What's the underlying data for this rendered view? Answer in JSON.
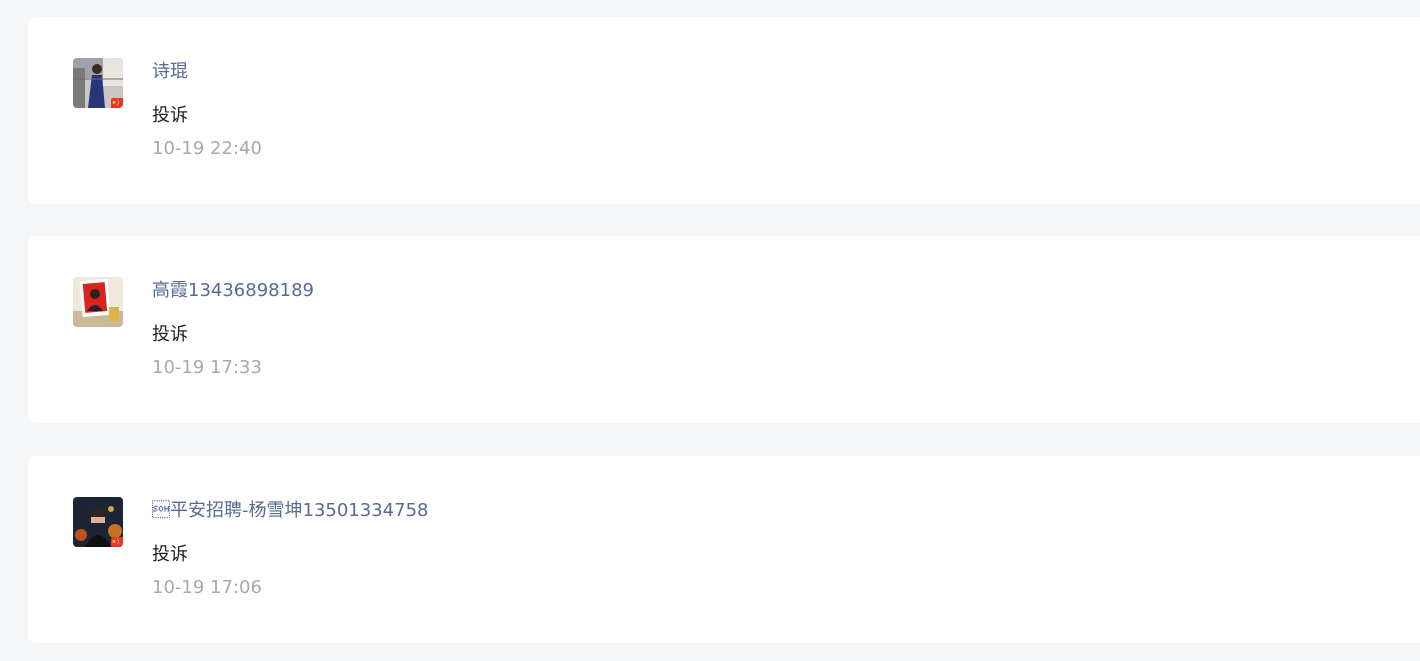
{
  "comments": [
    {
      "author": "诗琨",
      "text": "投诉",
      "time": "10-19 22:40",
      "avatar": "woman-in-blue-dress-photo",
      "badge": "china-flag-icon"
    },
    {
      "author": "高霞13436898189",
      "text": "投诉",
      "time": "10-19 17:33",
      "avatar": "framed-portrait-photo",
      "badge": ""
    },
    {
      "author": "\u0001平安招聘-杨雪坤13501334758",
      "text": "投诉",
      "time": "10-19 17:06",
      "avatar": "person-night-lights-photo",
      "badge": "china-flag-icon"
    }
  ]
}
